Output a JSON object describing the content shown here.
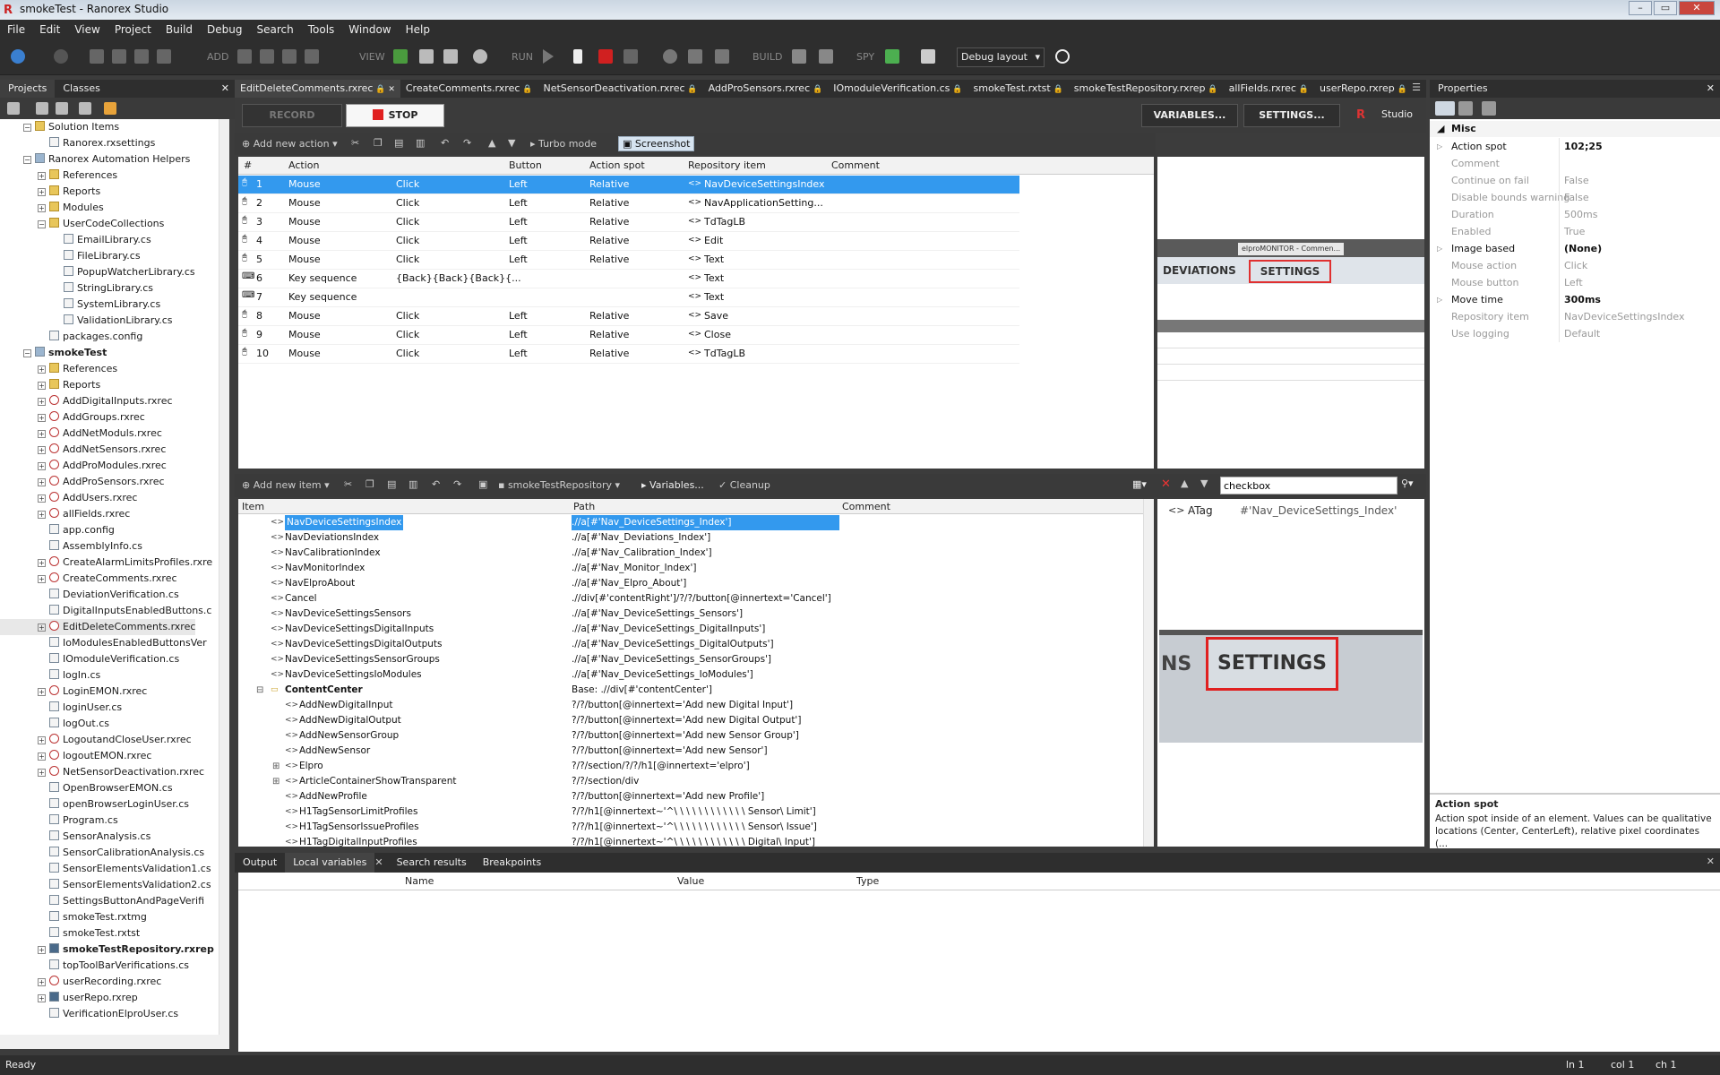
{
  "window": {
    "title": "smokeTest - Ranorex Studio",
    "logo": "R"
  },
  "menu": [
    "File",
    "Edit",
    "View",
    "Project",
    "Build",
    "Debug",
    "Search",
    "Tools",
    "Window",
    "Help"
  ],
  "toolbar": {
    "add": "ADD",
    "view": "VIEW",
    "run": "RUN",
    "build": "BUILD",
    "spy": "SPY",
    "layout": "Debug layout"
  },
  "projects_tabs": [
    "Projects",
    "Classes"
  ],
  "tree": [
    {
      "label": "Solution Items",
      "indent": 1,
      "icon": "fold",
      "exp": "−"
    },
    {
      "label": "Ranorex.rxsettings",
      "indent": 2,
      "icon": "file"
    },
    {
      "label": "Ranorex Automation Helpers",
      "indent": 1,
      "icon": "proj",
      "exp": "−"
    },
    {
      "label": "References",
      "indent": 2,
      "icon": "fold",
      "exp": "+"
    },
    {
      "label": "Reports",
      "indent": 2,
      "icon": "fold",
      "exp": "+"
    },
    {
      "label": "Modules",
      "indent": 2,
      "icon": "fold",
      "exp": "+"
    },
    {
      "label": "UserCodeCollections",
      "indent": 2,
      "icon": "fold",
      "exp": "−"
    },
    {
      "label": "EmailLibrary.cs",
      "indent": 3,
      "icon": "file"
    },
    {
      "label": "FileLibrary.cs",
      "indent": 3,
      "icon": "file"
    },
    {
      "label": "PopupWatcherLibrary.cs",
      "indent": 3,
      "icon": "file"
    },
    {
      "label": "StringLibrary.cs",
      "indent": 3,
      "icon": "file"
    },
    {
      "label": "SystemLibrary.cs",
      "indent": 3,
      "icon": "file"
    },
    {
      "label": "ValidationLibrary.cs",
      "indent": 3,
      "icon": "file"
    },
    {
      "label": "packages.config",
      "indent": 2,
      "icon": "file"
    },
    {
      "label": "smokeTest",
      "indent": 1,
      "icon": "proj",
      "exp": "−",
      "bold": true
    },
    {
      "label": "References",
      "indent": 2,
      "icon": "fold",
      "exp": "+"
    },
    {
      "label": "Reports",
      "indent": 2,
      "icon": "fold",
      "exp": "+"
    },
    {
      "label": "AddDigitalInputs.rxrec",
      "indent": 2,
      "icon": "rec",
      "exp": "+"
    },
    {
      "label": "AddGroups.rxrec",
      "indent": 2,
      "icon": "rec",
      "exp": "+"
    },
    {
      "label": "AddNetModuls.rxrec",
      "indent": 2,
      "icon": "rec",
      "exp": "+"
    },
    {
      "label": "AddNetSensors.rxrec",
      "indent": 2,
      "icon": "rec",
      "exp": "+"
    },
    {
      "label": "AddProModules.rxrec",
      "indent": 2,
      "icon": "rec",
      "exp": "+"
    },
    {
      "label": "AddProSensors.rxrec",
      "indent": 2,
      "icon": "rec",
      "exp": "+"
    },
    {
      "label": "AddUsers.rxrec",
      "indent": 2,
      "icon": "rec",
      "exp": "+"
    },
    {
      "label": "allFields.rxrec",
      "indent": 2,
      "icon": "rec",
      "exp": "+"
    },
    {
      "label": "app.config",
      "indent": 2,
      "icon": "file"
    },
    {
      "label": "AssemblyInfo.cs",
      "indent": 2,
      "icon": "file"
    },
    {
      "label": "CreateAlarmLimitsProfiles.rxre",
      "indent": 2,
      "icon": "rec",
      "exp": "+"
    },
    {
      "label": "CreateComments.rxrec",
      "indent": 2,
      "icon": "rec",
      "exp": "+"
    },
    {
      "label": "DeviationVerification.cs",
      "indent": 2,
      "icon": "file"
    },
    {
      "label": "DigitalInputsEnabledButtons.c",
      "indent": 2,
      "icon": "file"
    },
    {
      "label": "EditDeleteComments.rxrec",
      "indent": 2,
      "icon": "rec",
      "exp": "+",
      "sel": true
    },
    {
      "label": "IoModulesEnabledButtonsVer",
      "indent": 2,
      "icon": "file"
    },
    {
      "label": "IOmoduleVerification.cs",
      "indent": 2,
      "icon": "file"
    },
    {
      "label": "logIn.cs",
      "indent": 2,
      "icon": "file"
    },
    {
      "label": "LoginEMON.rxrec",
      "indent": 2,
      "icon": "rec",
      "exp": "+"
    },
    {
      "label": "loginUser.cs",
      "indent": 2,
      "icon": "file"
    },
    {
      "label": "logOut.cs",
      "indent": 2,
      "icon": "file"
    },
    {
      "label": "LogoutandCloseUser.rxrec",
      "indent": 2,
      "icon": "rec",
      "exp": "+"
    },
    {
      "label": "logoutEMON.rxrec",
      "indent": 2,
      "icon": "rec",
      "exp": "+"
    },
    {
      "label": "NetSensorDeactivation.rxrec",
      "indent": 2,
      "icon": "rec",
      "exp": "+"
    },
    {
      "label": "OpenBrowserEMON.cs",
      "indent": 2,
      "icon": "file"
    },
    {
      "label": "openBrowserLoginUser.cs",
      "indent": 2,
      "icon": "file"
    },
    {
      "label": "Program.cs",
      "indent": 2,
      "icon": "file"
    },
    {
      "label": "SensorAnalysis.cs",
      "indent": 2,
      "icon": "file"
    },
    {
      "label": "SensorCalibrationAnalysis.cs",
      "indent": 2,
      "icon": "file"
    },
    {
      "label": "SensorElementsValidation1.cs",
      "indent": 2,
      "icon": "file"
    },
    {
      "label": "SensorElementsValidation2.cs",
      "indent": 2,
      "icon": "file"
    },
    {
      "label": "SettingsButtonAndPageVerifi",
      "indent": 2,
      "icon": "file"
    },
    {
      "label": "smokeTest.rxtmg",
      "indent": 2,
      "icon": "file"
    },
    {
      "label": "smokeTest.rxtst",
      "indent": 2,
      "icon": "file"
    },
    {
      "label": "smokeTestRepository.rxrep",
      "indent": 2,
      "icon": "rep",
      "exp": "+",
      "bold": true
    },
    {
      "label": "topToolBarVerifications.cs",
      "indent": 2,
      "icon": "file"
    },
    {
      "label": "userRecording.rxrec",
      "indent": 2,
      "icon": "rec",
      "exp": "+"
    },
    {
      "label": "userRepo.rxrep",
      "indent": 2,
      "icon": "rep",
      "exp": "+"
    },
    {
      "label": "VerificationElproUser.cs",
      "indent": 2,
      "icon": "file"
    }
  ],
  "doc_tabs": [
    "EditDeleteComments.rxrec",
    "CreateComments.rxrec",
    "NetSensorDeactivation.rxrec",
    "AddProSensors.rxrec",
    "IOmoduleVerification.cs",
    "smokeTest.rxtst",
    "smokeTestRepository.rxrep",
    "allFields.rxrec",
    "userRepo.rxrep"
  ],
  "rec": {
    "record": "RECORD",
    "stop": "STOP",
    "variables": "VARIABLES...",
    "settings": "SETTINGS...",
    "studio": "Studio"
  },
  "actions_toolbar": {
    "add": "Add new action",
    "turbo": "Turbo mode",
    "screenshot": "Screenshot"
  },
  "actions_cols": [
    "#",
    "Action",
    "Button",
    "Action spot",
    "Repository item",
    "Comment"
  ],
  "actions": [
    {
      "n": "1",
      "a": "Mouse",
      "b": "Click",
      "btn": "Left",
      "spot": "Relative",
      "item": "NavDeviceSettingsIndex",
      "sel": true
    },
    {
      "n": "2",
      "a": "Mouse",
      "b": "Click",
      "btn": "Left",
      "spot": "Relative",
      "item": "NavApplicationSetting..."
    },
    {
      "n": "3",
      "a": "Mouse",
      "b": "Click",
      "btn": "Left",
      "spot": "Relative",
      "item": "TdTagLB"
    },
    {
      "n": "4",
      "a": "Mouse",
      "b": "Click",
      "btn": "Left",
      "spot": "Relative",
      "item": "Edit"
    },
    {
      "n": "5",
      "a": "Mouse",
      "b": "Click",
      "btn": "Left",
      "spot": "Relative",
      "item": "Text"
    },
    {
      "n": "6",
      "a": "Key sequence",
      "b": "{Back}{Back}{Back}{...",
      "btn": "",
      "spot": "",
      "item": "Text"
    },
    {
      "n": "7",
      "a": "Key sequence",
      "b": "",
      "btn": "",
      "spot": "",
      "item": "Text"
    },
    {
      "n": "8",
      "a": "Mouse",
      "b": "Click",
      "btn": "Left",
      "spot": "Relative",
      "item": "Save"
    },
    {
      "n": "9",
      "a": "Mouse",
      "b": "Click",
      "btn": "Left",
      "spot": "Relative",
      "item": "Close"
    },
    {
      "n": "10",
      "a": "Mouse",
      "b": "Click",
      "btn": "Left",
      "spot": "Relative",
      "item": "TdTagLB"
    }
  ],
  "preview": {
    "deviations": "DEVIATIONS",
    "settings": "SETTINGS",
    "browser_tab": "elproMONITOR - Commen...",
    "ns": "NS"
  },
  "repo_toolbar": {
    "add": "Add new item",
    "repo": "smokeTestRepository",
    "variables": "Variables...",
    "cleanup": "Cleanup",
    "search": "checkbox"
  },
  "repo_cols": [
    "Item",
    "Path",
    "Comment"
  ],
  "repo": [
    {
      "name": "NavDeviceSettingsIndex",
      "path": ".//a[#'Nav_DeviceSettings_Index']",
      "ind": 0,
      "sel": true
    },
    {
      "name": "NavDeviationsIndex",
      "path": ".//a[#'Nav_Deviations_Index']",
      "ind": 0
    },
    {
      "name": "NavCalibrationIndex",
      "path": ".//a[#'Nav_Calibration_Index']",
      "ind": 0
    },
    {
      "name": "NavMonitorIndex",
      "path": ".//a[#'Nav_Monitor_Index']",
      "ind": 0
    },
    {
      "name": "NavElproAbout",
      "path": ".//a[#'Nav_Elpro_About']",
      "ind": 0
    },
    {
      "name": "Cancel",
      "path": ".//div[#'contentRight']/?/?/button[@innertext='Cancel']",
      "ind": 0
    },
    {
      "name": "NavDeviceSettingsSensors",
      "path": ".//a[#'Nav_DeviceSettings_Sensors']",
      "ind": 0
    },
    {
      "name": "NavDeviceSettingsDigitalInputs",
      "path": ".//a[#'Nav_DeviceSettings_DigitalInputs']",
      "ind": 0
    },
    {
      "name": "NavDeviceSettingsDigitalOutputs",
      "path": ".//a[#'Nav_DeviceSettings_DigitalOutputs']",
      "ind": 0
    },
    {
      "name": "NavDeviceSettingsSensorGroups",
      "path": ".//a[#'Nav_DeviceSettings_SensorGroups']",
      "ind": 0
    },
    {
      "name": "NavDeviceSettingsIoModules",
      "path": ".//a[#'Nav_DeviceSettings_IoModules']",
      "ind": 0
    },
    {
      "name": "ContentCenter",
      "path": "Base: .//div[#'contentCenter']",
      "ind": -1,
      "folder": true
    },
    {
      "name": "AddNewDigitalInput",
      "path": "?/?/button[@innertext='Add new Digital Input']",
      "ind": 1
    },
    {
      "name": "AddNewDigitalOutput",
      "path": "?/?/button[@innertext='Add new Digital Output']",
      "ind": 1
    },
    {
      "name": "AddNewSensorGroup",
      "path": "?/?/button[@innertext='Add new Sensor Group']",
      "ind": 1
    },
    {
      "name": "AddNewSensor",
      "path": "?/?/button[@innertext='Add new Sensor']",
      "ind": 1
    },
    {
      "name": "Elpro",
      "path": "?/?/section/?/?/h1[@innertext='elpro']",
      "ind": 1,
      "exp": true
    },
    {
      "name": "ArticleContainerShowTransparent",
      "path": "?/?/section/div",
      "ind": 1,
      "exp": true
    },
    {
      "name": "AddNewProfile",
      "path": "?/?/button[@innertext='Add new Profile']",
      "ind": 1
    },
    {
      "name": "H1TagSensorLimitProfiles",
      "path": "?/?/h1[@innertext~'^\\ \\ \\ \\ \\ \\ \\ \\ \\ \\ \\ \\ Sensor\\ Limit']",
      "ind": 1
    },
    {
      "name": "H1TagSensorIssueProfiles",
      "path": "?/?/h1[@innertext~'^\\ \\ \\ \\ \\ \\ \\ \\ \\ \\ \\ \\ Sensor\\ Issue']",
      "ind": 1
    },
    {
      "name": "H1TagDigitalInputProfiles",
      "path": "?/?/h1[@innertext~'^\\ \\ \\ \\ \\ \\ \\ \\ \\ \\ \\ \\ Digital\\ Input']",
      "ind": 1
    }
  ],
  "repo_detail": {
    "tag": "ATag",
    "value": "#'Nav_DeviceSettings_Index'",
    "big": "SETTINGS",
    "ns": "NS"
  },
  "properties": {
    "title": "Properties",
    "section": "Misc",
    "rows": [
      {
        "k": "Action spot",
        "v": "102;25",
        "exp": true,
        "bold": true
      },
      {
        "k": "Comment",
        "v": "",
        "dim": true
      },
      {
        "k": "Continue on fail",
        "v": "False",
        "dim": true
      },
      {
        "k": "Disable bounds warning",
        "v": "False",
        "dim": true
      },
      {
        "k": "Duration",
        "v": "500ms",
        "dim": true
      },
      {
        "k": "Enabled",
        "v": "True",
        "dim": true
      },
      {
        "k": "Image based",
        "v": "(None)",
        "exp": true,
        "bold": true
      },
      {
        "k": "Mouse action",
        "v": "Click",
        "dim": true
      },
      {
        "k": "Mouse button",
        "v": "Left",
        "dim": true
      },
      {
        "k": "Move time",
        "v": "300ms",
        "exp": true,
        "bold": true
      },
      {
        "k": "Repository item",
        "v": "NavDeviceSettingsIndex",
        "dim": true
      },
      {
        "k": "Use logging",
        "v": "Default",
        "dim": true
      }
    ],
    "help_title": "Action spot",
    "help_text": "Action spot inside of an element. Values can be qualitative locations (Center, CenterLeft), relative pixel coordinates (..."
  },
  "bottom": {
    "tabs": [
      "Output",
      "Local variables",
      "Search results",
      "Breakpoints"
    ],
    "cols": [
      "Name",
      "Value",
      "Type"
    ]
  },
  "status": {
    "left": "Ready",
    "ln": "ln 1",
    "col": "col 1",
    "ch": "ch 1"
  }
}
